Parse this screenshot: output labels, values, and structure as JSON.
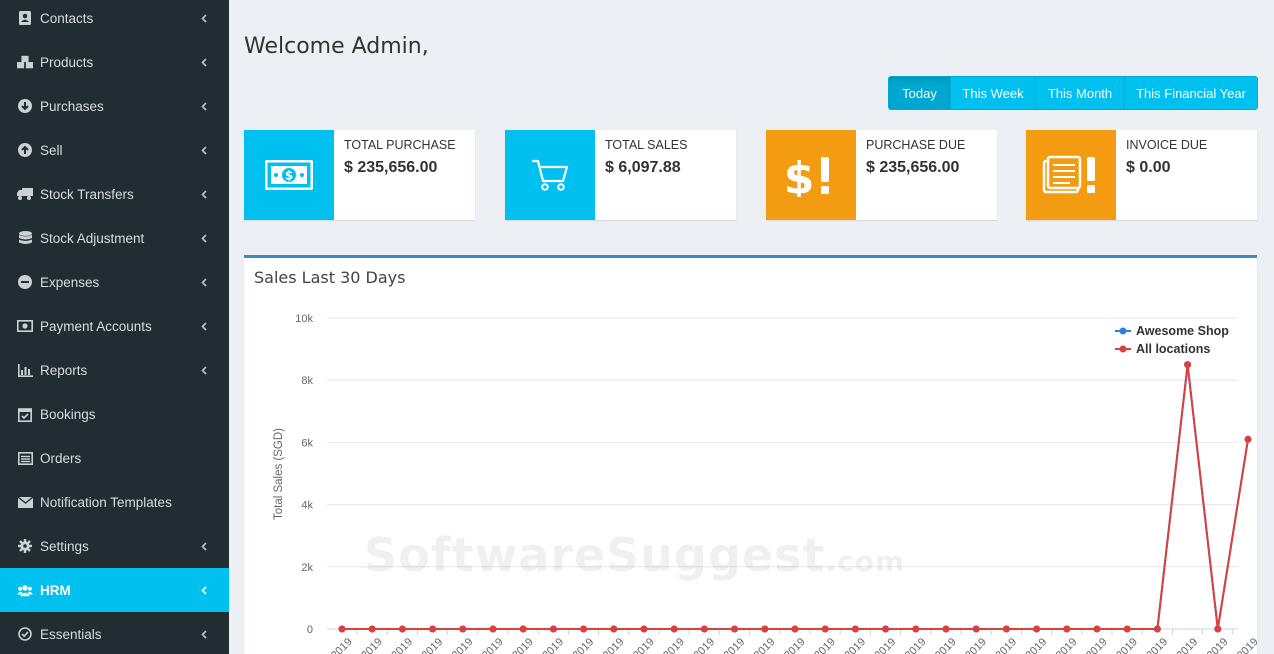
{
  "sidebar": {
    "items": [
      {
        "label": "Contacts",
        "icon": "contacts-icon",
        "chevron": true
      },
      {
        "label": "Products",
        "icon": "cubes-icon",
        "chevron": true
      },
      {
        "label": "Purchases",
        "icon": "arrow-circle-down-icon",
        "chevron": true
      },
      {
        "label": "Sell",
        "icon": "arrow-circle-up-icon",
        "chevron": true
      },
      {
        "label": "Stock Transfers",
        "icon": "truck-icon",
        "chevron": true
      },
      {
        "label": "Stock Adjustment",
        "icon": "database-icon",
        "chevron": true
      },
      {
        "label": "Expenses",
        "icon": "minus-circle-icon",
        "chevron": true
      },
      {
        "label": "Payment Accounts",
        "icon": "money-icon",
        "chevron": true
      },
      {
        "label": "Reports",
        "icon": "bar-chart-icon",
        "chevron": true
      },
      {
        "label": "Bookings",
        "icon": "calendar-check-icon",
        "chevron": false
      },
      {
        "label": "Orders",
        "icon": "list-alt-icon",
        "chevron": false
      },
      {
        "label": "Notification Templates",
        "icon": "envelope-icon",
        "chevron": false
      },
      {
        "label": "Settings",
        "icon": "cog-icon",
        "chevron": true
      },
      {
        "label": "HRM",
        "icon": "users-icon",
        "chevron": true,
        "active": true
      },
      {
        "label": "Essentials",
        "icon": "check-circle-icon",
        "chevron": true
      }
    ],
    "active_color": "#00c0ef",
    "bg_color": "#222d32"
  },
  "main": {
    "welcome": "Welcome Admin,",
    "date_filters": [
      "Today",
      "This Week",
      "This Month",
      "This Financial Year"
    ],
    "active_filter": "Today",
    "info_boxes": [
      {
        "label": "TOTAL PURCHASE",
        "value": "$ 235,656.00",
        "color": "#00c0ef",
        "icon": "money-bill-icon"
      },
      {
        "label": "TOTAL SALES",
        "value": "$ 6,097.88",
        "color": "#00c0ef",
        "icon": "shopping-cart-icon"
      },
      {
        "label": "PURCHASE DUE",
        "value": "$ 235,656.00",
        "color": "#f39c12",
        "icon": "dollar-exclamation-icon"
      },
      {
        "label": "INVOICE DUE",
        "value": "$ 0.00",
        "color": "#f39c12",
        "icon": "document-exclamation-icon"
      }
    ],
    "panel_title": "Sales Last 30 Days",
    "watermark": "SoftwareSuggest",
    "watermark_suffix": ".com"
  },
  "chart_data": {
    "type": "line",
    "ylabel": "Total Sales (SGD)",
    "ylim": [
      0,
      10000
    ],
    "yticks": [
      "0",
      "2k",
      "4k",
      "6k",
      "8k",
      "10k"
    ],
    "x_tick_label": "2019",
    "grid": true,
    "legend_position": "top-right",
    "series": [
      {
        "name": "Awesome Shop",
        "color": "#2f7ed8",
        "values": [
          0,
          0,
          0,
          0,
          0,
          0,
          0,
          0,
          0,
          0,
          0,
          0,
          0,
          0,
          0,
          0,
          0,
          0,
          0,
          0,
          0,
          0,
          0,
          0,
          0,
          0,
          0,
          0,
          8500,
          0,
          6100
        ]
      },
      {
        "name": "All locations",
        "color": "#d9403e",
        "values": [
          0,
          0,
          0,
          0,
          0,
          0,
          0,
          0,
          0,
          0,
          0,
          0,
          0,
          0,
          0,
          0,
          0,
          0,
          0,
          0,
          0,
          0,
          0,
          0,
          0,
          0,
          0,
          0,
          8500,
          0,
          6100
        ]
      }
    ]
  }
}
